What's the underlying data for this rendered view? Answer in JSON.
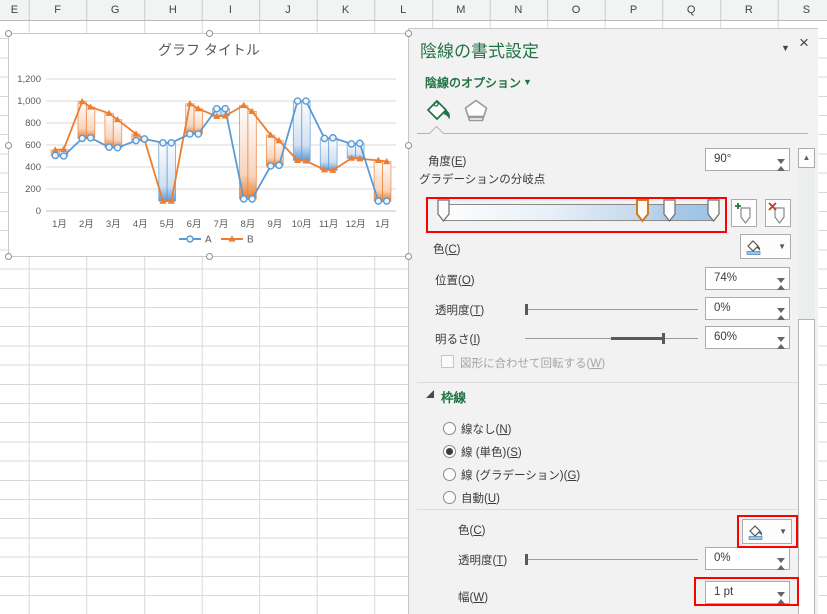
{
  "spreadsheet": {
    "column_headers": [
      "E",
      "F",
      "G",
      "H",
      "I",
      "J",
      "K",
      "L",
      "M",
      "N",
      "O",
      "P",
      "Q",
      "R",
      "S"
    ]
  },
  "chart_data": {
    "type": "line",
    "title": "グラフ タイトル",
    "categories": [
      "1月",
      "2月",
      "3月",
      "4月",
      "5月",
      "6月",
      "7月",
      "8月",
      "9月",
      "10月",
      "11月",
      "12月",
      "1月"
    ],
    "points_per_category": 2,
    "series": [
      {
        "name": "A",
        "color": "#5B9BD5",
        "marker": "circle",
        "values": [
          505,
          500,
          660,
          665,
          580,
          575,
          640,
          655,
          620,
          620,
          700,
          700,
          930,
          930,
          110,
          110,
          410,
          415,
          1000,
          1000,
          660,
          665,
          610,
          615,
          90,
          90
        ]
      },
      {
        "name": "B",
        "color": "#ED7D31",
        "marker": "triangle",
        "values": [
          555,
          560,
          995,
          945,
          888,
          830,
          700,
          650,
          90,
          90,
          975,
          930,
          860,
          865,
          960,
          905,
          690,
          640,
          460,
          455,
          375,
          370,
          480,
          475,
          460,
          450
        ]
      }
    ],
    "ylim": [
      0,
      1200
    ],
    "ytick_step": 200,
    "ytick_labels": [
      "0",
      "200",
      "400",
      "600",
      "800",
      "1,000",
      "1,200"
    ],
    "up_down_bars": true,
    "down_bar_gradient": [
      "#fdfdfd",
      "#cfe0f1",
      "#a5c6e8",
      "#5B9BD5"
    ],
    "up_bar_gradient": [
      "#fdfdfd",
      "#f6d4bc",
      "#f0b184",
      "#ED7D31"
    ],
    "gradient_stop_positions": [
      0,
      74,
      84,
      100
    ],
    "legend_position": "bottom",
    "grid": true
  },
  "panel": {
    "title": "陰線の書式設定",
    "collapse_icon": "▼",
    "close_icon": "×",
    "options_label": "陰線のオプション",
    "options_caret": "▼",
    "tabs": [
      {
        "name": "fill-and-line"
      },
      {
        "name": "effects"
      }
    ],
    "angle": {
      "label": "角度(E)",
      "value": "90°"
    },
    "gradient": {
      "label": "グラデーションの分岐点",
      "stops": [
        {
          "pos": 0,
          "selected": false
        },
        {
          "pos": 74,
          "selected": true
        },
        {
          "pos": 84,
          "selected": false
        },
        {
          "pos": 100,
          "selected": false
        }
      ]
    },
    "stop_color": {
      "label": "色(C)"
    },
    "position": {
      "label": "位置(O)",
      "value": "74%"
    },
    "transparency": {
      "label": "透明度(T)",
      "value": "0%",
      "slider_percent": 0
    },
    "brightness": {
      "label": "明るさ(I)",
      "value": "60%",
      "slider_percent": 60
    },
    "rotate_with_shape": {
      "label": "図形に合わせて回転する(W)",
      "checked": false,
      "disabled": true
    },
    "border": {
      "label": "枠線",
      "options": [
        {
          "label": "線なし(N)",
          "selected": false
        },
        {
          "label": "線 (単色)(S)",
          "selected": true
        },
        {
          "label": "線 (グラデーション)(G)",
          "selected": false
        },
        {
          "label": "自動(U)",
          "selected": false
        }
      ],
      "color": {
        "label": "色(C)"
      },
      "transparency": {
        "label": "透明度(T)",
        "value": "0%",
        "slider_percent": 0
      },
      "width": {
        "label": "幅(W)",
        "value": "1 pt"
      }
    },
    "scrollbar_up_icon": "▲",
    "accent_green": "#217346",
    "annotation_red": "#ff0000"
  }
}
